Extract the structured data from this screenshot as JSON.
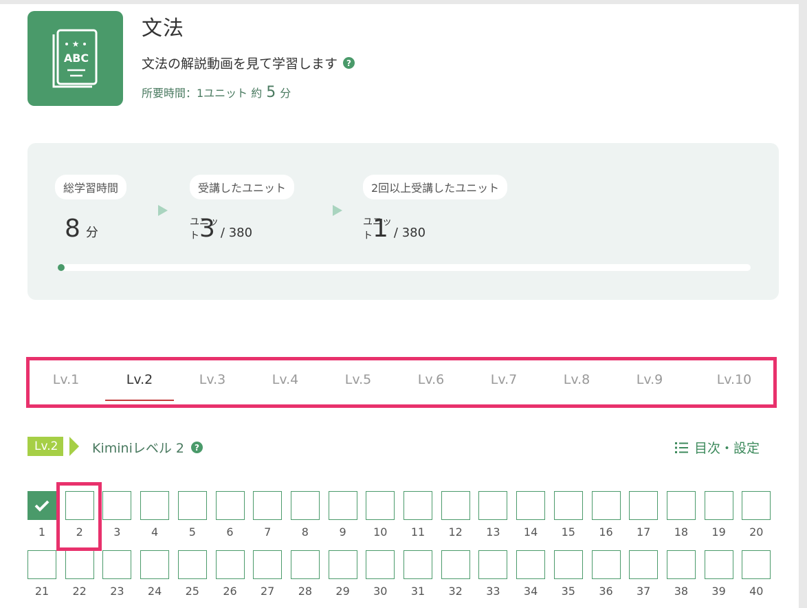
{
  "course": {
    "title": "文法",
    "description": "文法の解説動画を見て学習します",
    "time_label": "所要時間：1ユニット 約",
    "time_value": "5",
    "time_unit": "分",
    "icon": "book-abc-icon",
    "icon_text": "ABC"
  },
  "stats": {
    "total_time": {
      "label": "総学習時間",
      "value": "8",
      "unit": "分"
    },
    "units_taken": {
      "label": "受講したユニット",
      "value": "3",
      "total": "/ 380",
      "unit": "ユニット"
    },
    "units_repeated": {
      "label": "2回以上受講したユニット",
      "value": "1",
      "total": "/ 380",
      "unit": "ユニット"
    },
    "progress": 0.008
  },
  "levels": {
    "tabs": [
      "Lv.1",
      "Lv.2",
      "Lv.3",
      "Lv.4",
      "Lv.5",
      "Lv.6",
      "Lv.7",
      "Lv.8",
      "Lv.9",
      "Lv.10"
    ],
    "active_index": 1
  },
  "level_section": {
    "badge": "Lv.2",
    "name": "Kiminiレベル 2",
    "toc_label": "目次・設定"
  },
  "units": {
    "row1": [
      "1",
      "2",
      "3",
      "4",
      "5",
      "6",
      "7",
      "8",
      "9",
      "10",
      "11",
      "12",
      "13",
      "14",
      "15",
      "16",
      "17",
      "18",
      "19",
      "20"
    ],
    "row2": [
      "21",
      "22",
      "23",
      "24",
      "25",
      "26",
      "27",
      "28",
      "29",
      "30",
      "31",
      "32",
      "33",
      "34",
      "35",
      "36",
      "37",
      "38",
      "39",
      "40"
    ],
    "completed": [
      "1"
    ]
  },
  "colors": {
    "brand_green": "#4a9a6a",
    "highlight": "#e8316c",
    "badge_green": "#a6cf46"
  }
}
